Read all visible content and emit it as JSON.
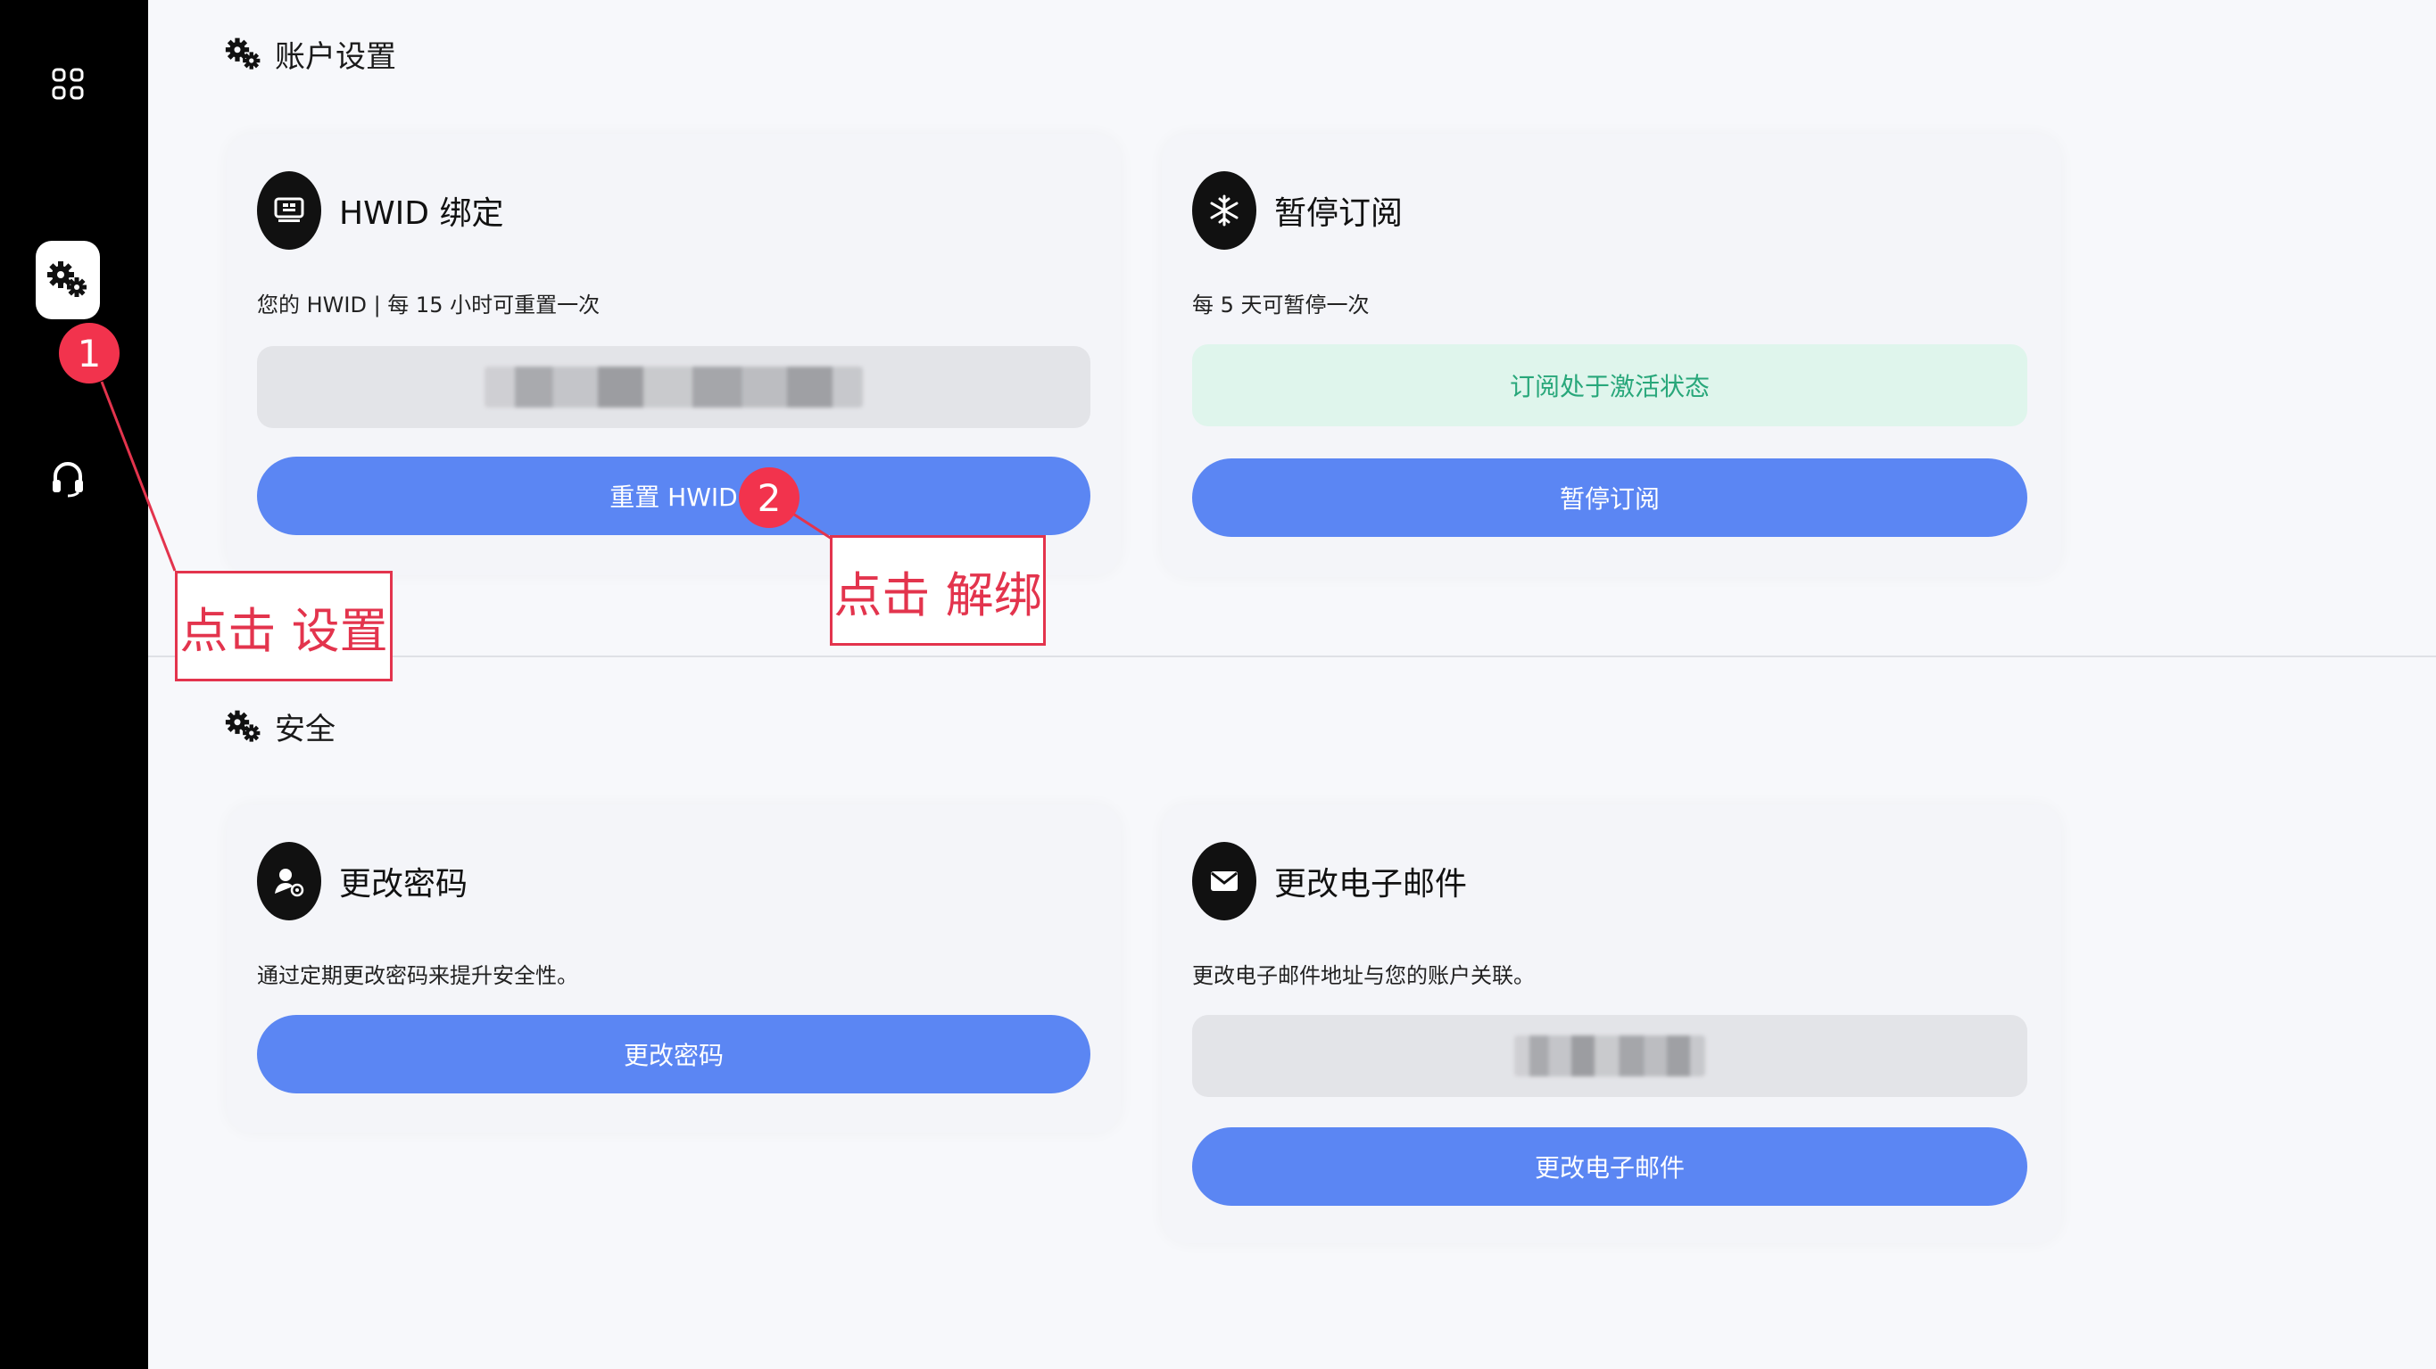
{
  "sidebar": {
    "items": [
      {
        "name": "apps",
        "icon": "grid-icon"
      },
      {
        "name": "settings",
        "icon": "gears-icon",
        "active": true
      },
      {
        "name": "support",
        "icon": "headset-icon"
      }
    ]
  },
  "account_section": {
    "title": "账户设置",
    "hwid_card": {
      "title": "HWID 绑定",
      "desc": "您的 HWID | 每 15 小时可重置一次",
      "button": "重置 HWID"
    },
    "pause_card": {
      "title": "暂停订阅",
      "desc": "每 5 天可暂停一次",
      "status": "订阅处于激活状态",
      "button": "暂停订阅"
    }
  },
  "security_section": {
    "title": "安全",
    "password_card": {
      "title": "更改密码",
      "desc": "通过定期更改密码来提升安全性。",
      "button": "更改密码"
    },
    "email_card": {
      "title": "更改电子邮件",
      "desc": "更改电子邮件地址与您的账户关联。",
      "button": "更改电子邮件"
    }
  },
  "annotations": {
    "step1_number": "1",
    "step1_label": "点击 设置",
    "step2_number": "2",
    "step2_label": "点击 解绑"
  },
  "colors": {
    "primary": "#5b86f3",
    "annotation": "#e3344d",
    "status_text": "#28a77a",
    "status_bg": "#dff5ec"
  }
}
